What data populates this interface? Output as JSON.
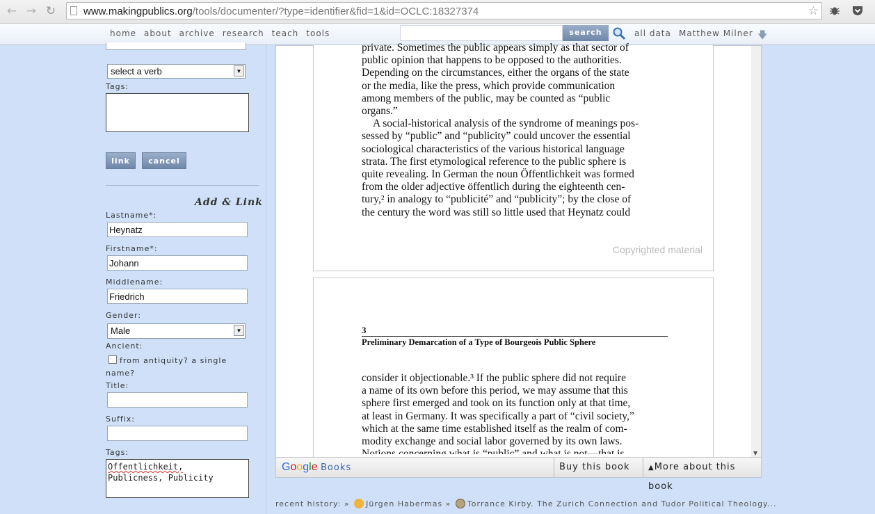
{
  "browser": {
    "url_prefix": "www.makingpublics.org",
    "url_rest": "/tools/documenter/?type=identifier&fid=1&id=OCLC:18327374"
  },
  "nav": {
    "links": [
      "home",
      "about",
      "archive",
      "research",
      "teach",
      "tools"
    ],
    "search_button": "search",
    "all_data": "all data",
    "user_name": "Matthew Milner"
  },
  "form": {
    "verb_select": "select a verb",
    "tags_label_top": "Tags:",
    "link_button": "link",
    "cancel_button": "cancel",
    "add_link_heading": "Add & Link",
    "lastname_label": "Lastname*:",
    "lastname_value": "Heynatz",
    "firstname_label": "Firstname*:",
    "firstname_value": "Johann",
    "middlename_label": "Middlename:",
    "middlename_value": "Friedrich",
    "gender_label": "Gender:",
    "gender_value": "Male",
    "ancient_label": "Ancient:",
    "ancient_option_line1": "from antiquity? a single",
    "ancient_option_line2": "name?",
    "title_label": "Title:",
    "title_value": "",
    "suffix_label": "Suffix:",
    "suffix_value": "",
    "tags_label": "Tags:",
    "tags_line1": "Offentlichkeit,",
    "tags_line2": "Publicness, Publicity"
  },
  "viewer": {
    "page1_lines": [
      "private. Sometimes the public appears simply as that sector of",
      "public opinion that happens to be opposed to the authorities.",
      "Depending on the circumstances, either the organs of the state",
      "or the media, like the press, which provide communication",
      "among members of the public, may be counted as “public",
      "organs.”"
    ],
    "page1_para2": [
      "A social-historical analysis of the syndrome of meanings pos-",
      "sessed by “public” and “publicity” could uncover the essential",
      "sociological characteristics of the various historical language",
      "strata. The first etymological reference to the public sphere is",
      "quite revealing. In German the noun Öffentlichkeit was formed",
      "from the older adjective öffentlich during the eighteenth cen-",
      "tury,² in analogy to “publicité” and “publicity”; by the close of",
      "the century the word was still so little used that Heynatz could"
    ],
    "copyright": "Copyrighted material",
    "chapter_number": "3",
    "chapter_title": "Preliminary Demarcation of a Type of Bourgeois Public Sphere",
    "page2_lines": [
      "consider it objectionable.³ If the public sphere did not require",
      "a name of its own before this period, we may assume that this",
      "sphere first emerged and took on its function only at that time,",
      "at least in Germany. It was specifically a part of “civil society,”",
      "which at the same time established itself as the realm of com-",
      "modity exchange and social labor governed by its own laws.",
      "Notions concerning what is “public” and what is not—that is,"
    ],
    "google_brand": "Google",
    "books_label": "Books",
    "buy_button": "Buy this book",
    "more_button": "More about this book"
  },
  "history": {
    "label": "recent history: »",
    "item1": "Jürgen Habermas",
    "separator": "»",
    "item2": "Torrance Kirby. The Zurich Connection and Tudor Political Theology..."
  },
  "colors": {
    "background": "#cfe0f8",
    "button": "#7f95b4",
    "link_blue": "#3367b5"
  }
}
